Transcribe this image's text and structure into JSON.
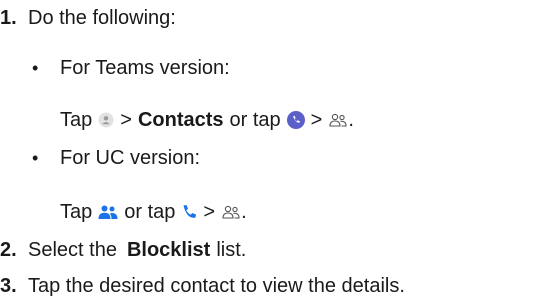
{
  "steps": [
    {
      "number": "1.",
      "text": "Do the following:"
    },
    {
      "number": "2.",
      "pre": "Select the",
      "bold": "Blocklist",
      "post": "list."
    },
    {
      "number": "3.",
      "text": "Tap the desired contact to view the details."
    }
  ],
  "bullets": [
    {
      "symbol": "•",
      "label": "For Teams version:",
      "instruction": {
        "tap": "Tap",
        "gt1": ">",
        "bold": "Contacts",
        "or_tap": "or tap",
        "gt2": ">",
        "end": ".",
        "icons": [
          "avatar-gray-icon",
          "phone-circle-purple-icon",
          "people-outline-icon"
        ]
      }
    },
    {
      "symbol": "•",
      "label": "For UC version:",
      "instruction": {
        "tap": "Tap",
        "or_tap": "or tap",
        "gt": ">",
        "end": ".",
        "icons": [
          "people-blue-icon",
          "phone-blue-icon",
          "people-outline-icon"
        ]
      }
    }
  ],
  "colors": {
    "text": "#1a1a1a",
    "purple": "#5b5fc7",
    "blue": "#1a73e8",
    "icon_gray": "#9a9a9a"
  }
}
